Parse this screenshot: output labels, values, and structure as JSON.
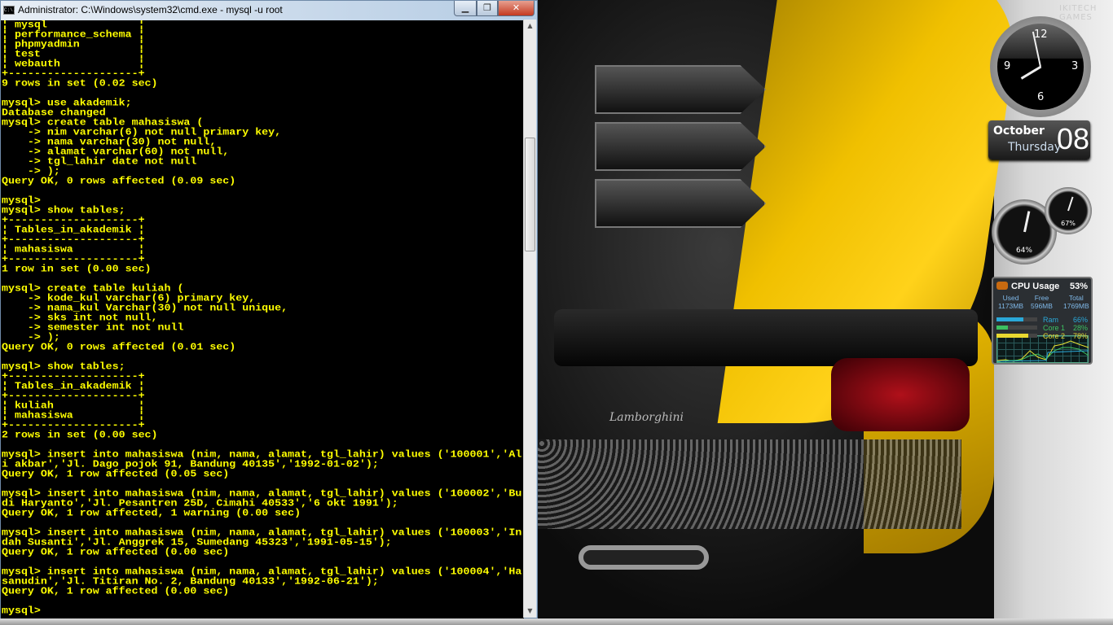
{
  "window": {
    "title": "Administrator: C:\\Windows\\system32\\cmd.exe - mysql  -u root",
    "icon": "cmd-icon",
    "icon_text": "C:\\.",
    "min_glyph": "▁",
    "max_glyph": "❐",
    "close_glyph": "✕"
  },
  "console": {
    "text_color": "#ffff00",
    "background": "#000000",
    "lines": [
      "¦ mysql              ¦",
      "¦ performance_schema ¦",
      "¦ phpmyadmin         ¦",
      "¦ test               ¦",
      "¦ webauth            ¦",
      "+--------------------+",
      "9 rows in set (0.02 sec)",
      "",
      "mysql> use akademik;",
      "Database changed",
      "mysql> create table mahasiswa (",
      "    -> nim varchar(6) not null primary key,",
      "    -> nama varchar(30) not null,",
      "    -> alamat varchar(60) not null,",
      "    -> tgl_lahir date not null",
      "    -> );",
      "Query OK, 0 rows affected (0.09 sec)",
      "",
      "mysql>",
      "mysql> show tables;",
      "+--------------------+",
      "¦ Tables_in_akademik ¦",
      "+--------------------+",
      "¦ mahasiswa          ¦",
      "+--------------------+",
      "1 row in set (0.00 sec)",
      "",
      "mysql> create table kuliah (",
      "    -> kode_kul varchar(6) primary key,",
      "    -> nama_kul Varchar(30) not null unique,",
      "    -> sks int not null,",
      "    -> semester int not null",
      "    -> );",
      "Query OK, 0 rows affected (0.01 sec)",
      "",
      "mysql> show tables;",
      "+--------------------+",
      "¦ Tables_in_akademik ¦",
      "+--------------------+",
      "¦ kuliah             ¦",
      "¦ mahasiswa          ¦",
      "+--------------------+",
      "2 rows in set (0.00 sec)",
      "",
      "mysql> insert into mahasiswa (nim, nama, alamat, tgl_lahir) values ('100001','Al",
      "i akbar','Jl. Dago pojok 91, Bandung 40135','1992-01-02');",
      "Query OK, 1 row affected (0.05 sec)",
      "",
      "mysql> insert into mahasiswa (nim, nama, alamat, tgl_lahir) values ('100002','Bu",
      "di Haryanto','Jl. Pesantren 25D, Cimahi 40533','6 okt 1991');",
      "Query OK, 1 row affected, 1 warning (0.00 sec)",
      "",
      "mysql> insert into mahasiswa (nim, nama, alamat, tgl_lahir) values ('100003','In",
      "dah Susanti','Jl. Anggrek 15, Sumedang 45323','1991-05-15');",
      "Query OK, 1 row affected (0.00 sec)",
      "",
      "mysql> insert into mahasiswa (nim, nama, alamat, tgl_lahir) values ('100004','Ha",
      "sanudin','Jl. Titiran No. 2, Bandung 40133','1992-06-21');",
      "Query OK, 1 row affected (0.00 sec)",
      "",
      "mysql>"
    ]
  },
  "scrollbar": {
    "up": "▲",
    "down": "▼"
  },
  "wallpaper": {
    "brand": "Lamborghini",
    "watermark": "IKITECH\nGAMES"
  },
  "clock": {
    "numerals": [
      "12",
      "3",
      "6",
      "9"
    ],
    "time": "7:58"
  },
  "calendar": {
    "month": "October",
    "weekday": "Thursday",
    "day": "08"
  },
  "gauges": {
    "cpu": "64%",
    "memory": "67%"
  },
  "cpu_meter": {
    "title": "CPU Usage",
    "total_pct": "53%",
    "used_label": "Used",
    "free_label": "Free",
    "total_label": "Total",
    "used": "1173MB",
    "free": "596MB",
    "total": "1769MB",
    "bars": [
      {
        "label": "Ram",
        "value": "66%",
        "pct": 66,
        "color": "#2aa8d8"
      },
      {
        "label": "Core 1",
        "value": "28%",
        "pct": 28,
        "color": "#3cc060"
      },
      {
        "label": "Core 2",
        "value": "78%",
        "pct": 78,
        "color": "#e8d830"
      }
    ]
  }
}
